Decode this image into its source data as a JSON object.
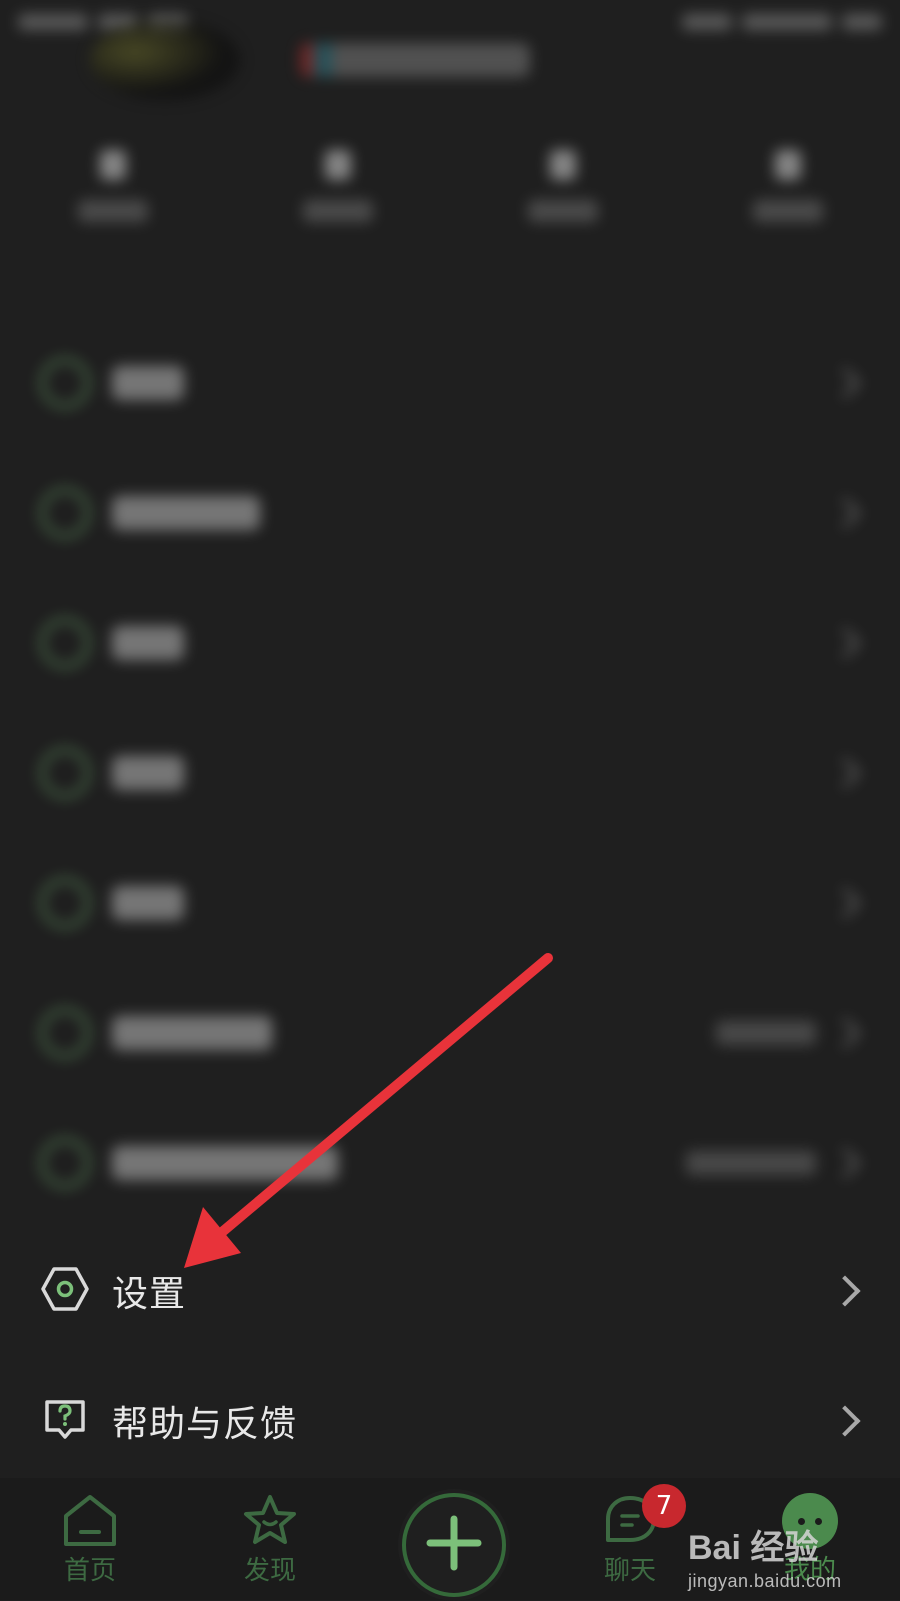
{
  "status_bar": {},
  "menu": {
    "settings_label": "设置",
    "help_label": "帮助与反馈"
  },
  "bottom_nav": {
    "home_label": "首页",
    "discover_label": "发现",
    "chat_label": "聊天",
    "chat_badge": "7",
    "me_label": "我的",
    "active_tab": "我的",
    "accent_color": "#4b8a4d",
    "inactive_color": "#3d6a42",
    "badge_color": "#c8282e"
  },
  "icons": {
    "settings": "hexagon-gear-icon",
    "help": "question-bubble-icon",
    "home": "house-icon",
    "discover": "star-icon",
    "create": "plus-icon",
    "chat": "chat-bubble-icon",
    "me": "face-avatar-icon",
    "row_arrow": "chevron-right-icon"
  },
  "annotation": {
    "arrow_color": "#e8333a"
  },
  "watermark": {
    "brand_text": "Bai  经验",
    "url_text": "jingyan.baidu.com"
  }
}
